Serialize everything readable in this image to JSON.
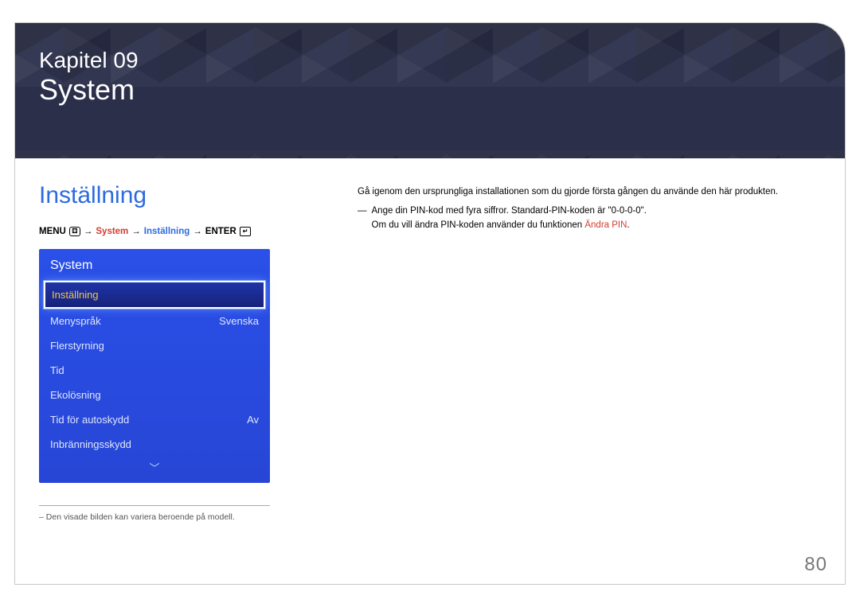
{
  "chapter": {
    "kicker": "Kapitel 09",
    "title": "System"
  },
  "section_title": "Inställning",
  "breadcrumb": {
    "menu_label": "MENU",
    "menu_glyph": "⚃",
    "arrow": "→",
    "system_label": "System",
    "sub_label": "Inställning",
    "enter_label": "ENTER",
    "enter_glyph": "↵"
  },
  "osd": {
    "title": "System",
    "items": [
      {
        "label": "Inställning",
        "value": "",
        "selected": true
      },
      {
        "label": "Menyspråk",
        "value": "Svenska",
        "selected": false
      },
      {
        "label": "Flerstyrning",
        "value": "",
        "selected": false
      },
      {
        "label": "Tid",
        "value": "",
        "selected": false
      },
      {
        "label": "Ekolösning",
        "value": "",
        "selected": false
      },
      {
        "label": "Tid för autoskydd",
        "value": "Av",
        "selected": false
      },
      {
        "label": "Inbränningsskydd",
        "value": "",
        "selected": false
      }
    ],
    "scroll_glyph": "﹀"
  },
  "footnote_prefix": "–",
  "footnote": "Den visade bilden kan variera beroende på modell.",
  "right": {
    "intro": "Gå igenom den ursprungliga installationen som du gjorde första gången du använde den här produkten.",
    "dash": "―",
    "pin_line1": "Ange din PIN-kod med fyra siffror. Standard-PIN-koden är \"0-0-0-0\".",
    "pin_line2_pre": "Om du vill ändra PIN-koden använder du funktionen ",
    "pin_line2_link": "Ändra PIN",
    "pin_line2_post": "."
  },
  "page_number": "80"
}
